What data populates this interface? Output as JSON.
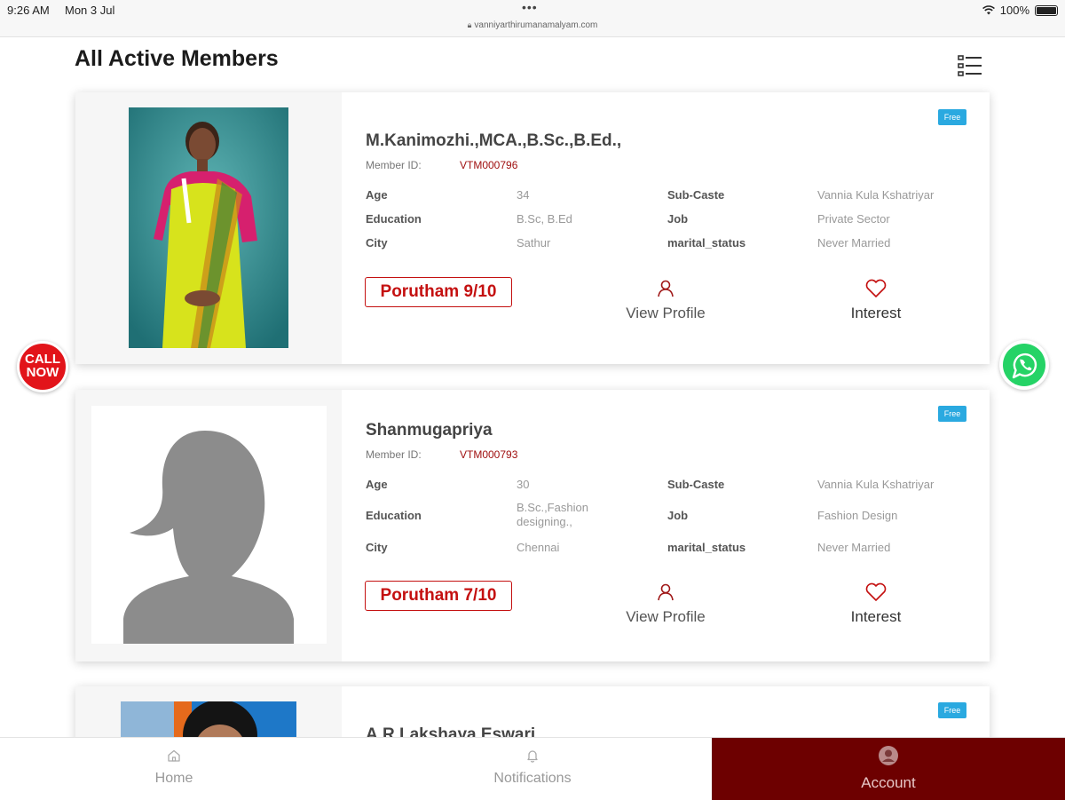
{
  "status_bar": {
    "time": "9:26 AM",
    "date": "Mon 3 Jul",
    "dots": "•••",
    "url": "vanniyarthirumanamalyam.com",
    "battery": "100%",
    "battery_level": 1.0
  },
  "page": {
    "title": "All Active Members",
    "list_view_icon": "list-view-icon"
  },
  "labels": {
    "member_id": "Member ID:",
    "age": "Age",
    "education": "Education",
    "city": "City",
    "sub_caste": "Sub-Caste",
    "job": "Job",
    "marital_status": "marital_status",
    "view_profile": "View Profile",
    "interest": "Interest",
    "badge": "Free"
  },
  "members": [
    {
      "name": "M.Kanimozhi.,MCA.,B.Sc.,B.Ed.,",
      "member_id": "VTM000796",
      "age": "34",
      "education": "B.Sc, B.Ed",
      "city": "Sathur",
      "sub_caste": "Vannia Kula Kshatriyar",
      "job": "Private Sector",
      "marital_status": "Never Married",
      "porutham": "Porutham 9/10"
    },
    {
      "name": "Shanmugapriya",
      "member_id": "VTM000793",
      "age": "30",
      "education": "B.Sc.,Fashion designing.,",
      "city": "Chennai",
      "sub_caste": "Vannia Kula Kshatriyar",
      "job": "Fashion Design",
      "marital_status": "Never Married",
      "porutham": "Porutham 7/10"
    },
    {
      "name": "A.R.Lakshaya Eswari"
    }
  ],
  "floating": {
    "call_now_line1": "CALL",
    "call_now_line2": "NOW"
  },
  "bottom_nav": {
    "home": "Home",
    "notifications": "Notifications",
    "account": "Account"
  },
  "colors": {
    "accent": "#6d0000",
    "porutham": "#c41010",
    "badge": "#2aa9e0",
    "call_now": "#e2141a",
    "whatsapp": "#25d366"
  }
}
